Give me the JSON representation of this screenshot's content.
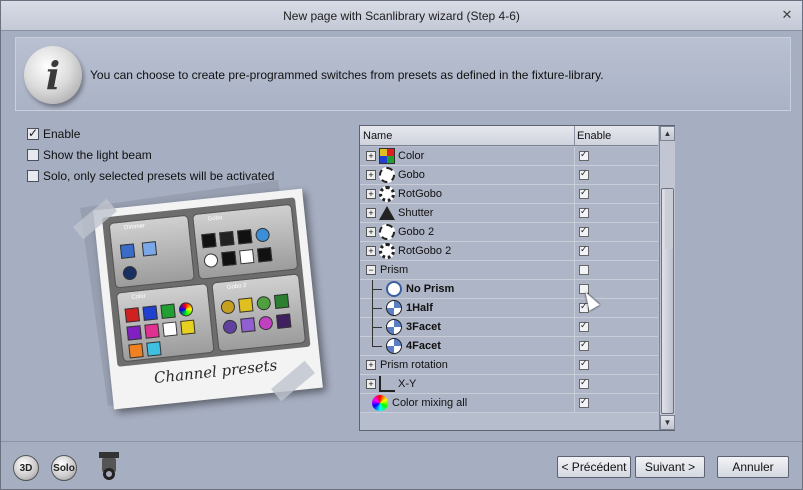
{
  "window": {
    "title": "New page with Scanlibrary wizard (Step 4-6)",
    "close_glyph": "✕"
  },
  "info": {
    "icon_letter": "i",
    "text": "You can choose to create pre-programmed switches from presets as defined in the fixture-library."
  },
  "options": [
    {
      "label": "Enable",
      "checked": true
    },
    {
      "label": "Show the light beam",
      "checked": false
    },
    {
      "label": "Solo, only selected presets will be activated",
      "checked": false
    }
  ],
  "preview": {
    "caption": "Channel presets",
    "cards": {
      "dimmer": "Dimmer",
      "gobo": "Gobo",
      "color": "Color",
      "gobo2": "Gobo 2"
    }
  },
  "grid": {
    "columns": {
      "name": "Name",
      "enable": "Enable"
    },
    "rows": [
      {
        "label": "Color",
        "icon": "color-grid-icon",
        "expander": "+",
        "checked": true
      },
      {
        "label": "Gobo",
        "icon": "gobo-icon",
        "expander": "+",
        "checked": true
      },
      {
        "label": "RotGobo",
        "icon": "rotgobo-icon",
        "expander": "+",
        "checked": true
      },
      {
        "label": "Shutter",
        "icon": "shutter-icon",
        "expander": "+",
        "checked": true
      },
      {
        "label": "Gobo 2",
        "icon": "gobo-icon",
        "expander": "+",
        "checked": true
      },
      {
        "label": "RotGobo 2",
        "icon": "rotgobo-icon",
        "expander": "+",
        "checked": true
      },
      {
        "label": "Prism",
        "icon": "",
        "expander": "−",
        "checked": false
      },
      {
        "label": "No Prism",
        "icon": "no-prism-icon",
        "expander": "",
        "checked": false
      },
      {
        "label": "1Half",
        "icon": "prism-icon",
        "expander": "",
        "checked": true
      },
      {
        "label": "3Facet",
        "icon": "prism-icon",
        "expander": "",
        "checked": true
      },
      {
        "label": "4Facet",
        "icon": "prism-icon",
        "expander": "",
        "checked": true
      },
      {
        "label": "Prism rotation",
        "icon": "",
        "expander": "+",
        "checked": true
      },
      {
        "label": "X-Y",
        "icon": "xy-icon",
        "expander": "+",
        "checked": true
      },
      {
        "label": "Color mixing all",
        "icon": "color-mix-icon",
        "expander": "",
        "checked": true
      }
    ]
  },
  "footer": {
    "btn_3d": "3D",
    "btn_solo": "Solo",
    "previous": "< Précédent",
    "next": "Suivant >",
    "cancel": "Annuler"
  }
}
